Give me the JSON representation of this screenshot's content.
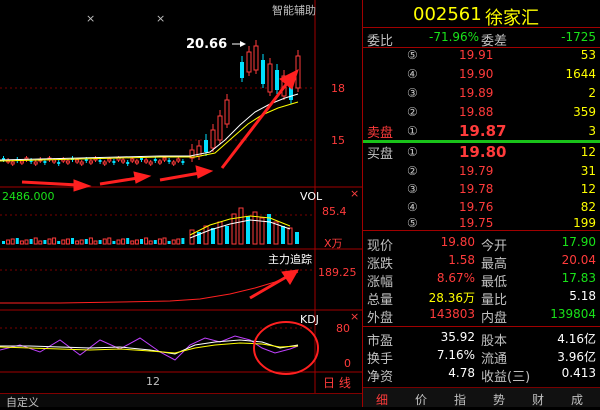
{
  "header": {
    "code": "002561",
    "name": "徐家汇"
  },
  "chart_toolbar": {
    "assist_label": "智能辅助",
    "x_marks": [
      "×",
      "×"
    ]
  },
  "price_panel": {
    "annotation": "20.66",
    "levels": [
      "18",
      "15"
    ],
    "base_value": "2486.000"
  },
  "vol_panel": {
    "title": "VOL",
    "value": "85.4",
    "unit": "X万"
  },
  "flow_panel": {
    "title": "主力追踪",
    "value": "189.25"
  },
  "kdj_panel": {
    "title": "KDJ",
    "top_value": "80",
    "bottom_value": "0"
  },
  "x_axis": {
    "label": "12",
    "period_label": "日 线"
  },
  "footer": {
    "custom_label": "自定义"
  },
  "committee": {
    "ratio_label": "委比",
    "ratio_value": "-71.96%",
    "diff_label": "委差",
    "diff_value": "-1725"
  },
  "sell_label": "卖盘",
  "buy_label": "买盘",
  "asks": [
    {
      "level": "⑤",
      "price": "19.91",
      "vol": "53"
    },
    {
      "level": "④",
      "price": "19.90",
      "vol": "1644"
    },
    {
      "level": "③",
      "price": "19.89",
      "vol": "2"
    },
    {
      "level": "②",
      "price": "19.88",
      "vol": "359"
    },
    {
      "level": "①",
      "price": "19.87",
      "vol": "3"
    }
  ],
  "bids": [
    {
      "level": "①",
      "price": "19.80",
      "vol": "12"
    },
    {
      "level": "②",
      "price": "19.79",
      "vol": "31"
    },
    {
      "level": "③",
      "price": "19.78",
      "vol": "12"
    },
    {
      "level": "④",
      "price": "19.76",
      "vol": "82"
    },
    {
      "level": "⑤",
      "price": "19.75",
      "vol": "199"
    }
  ],
  "quote": {
    "now_label": "现价",
    "now": "19.80",
    "open_label": "今开",
    "open": "17.90",
    "chg_label": "涨跌",
    "chg": "1.58",
    "high_label": "最高",
    "high": "20.04",
    "pct_label": "涨幅",
    "pct": "8.67%",
    "low_label": "最低",
    "low": "17.83",
    "vol_label": "总量",
    "vol": "28.36万",
    "ratio_label": "量比",
    "ratio": "5.18",
    "outer_label": "外盘",
    "outer": "143803",
    "inner_label": "内盘",
    "inner": "139804",
    "pe_label": "市盈",
    "pe": "35.92",
    "cap_label": "股本",
    "cap": "4.16亿",
    "turn_label": "换手",
    "turn": "7.16%",
    "float_label": "流通",
    "float": "3.96亿",
    "nav_label": "净资",
    "nav": "4.78",
    "earn_label": "收益(三)",
    "earn": "0.413"
  },
  "tabs": [
    "细",
    "价",
    "指",
    "势",
    "财",
    "成"
  ],
  "colors": {
    "up": "#ff3b3b",
    "down": "#19e219",
    "accent": "#ffff00",
    "frame": "#a00000",
    "candle_down": "#00e0ff"
  }
}
